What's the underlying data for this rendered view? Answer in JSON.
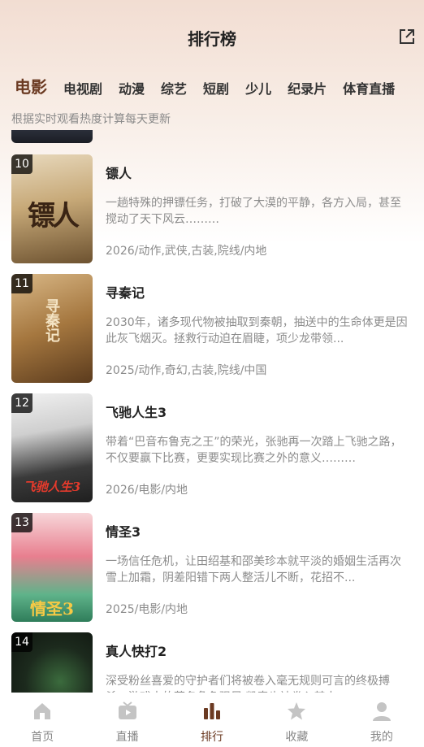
{
  "header": {
    "title": "排行榜"
  },
  "tabs": [
    "电影",
    "电视剧",
    "动漫",
    "综艺",
    "短剧",
    "少儿",
    "纪录片",
    "体育直播"
  ],
  "subtitle": "根据实时观看热度计算每天更新",
  "items": [
    {
      "rank": "10",
      "title": "镖人",
      "desc": "一趟特殊的押镖任务，打破了大漠的平静，各方入局，甚至搅动了天下风云………",
      "meta": "2026/动作,武侠,古装,院线/内地",
      "poster_text": "镖人"
    },
    {
      "rank": "11",
      "title": "寻秦记",
      "desc": "2030年，诸多现代物被抽取到秦朝，抽送中的生命体更是因此灰飞烟灭。拯救行动迫在眉睫，项少龙带领...",
      "meta": "2025/动作,奇幻,古装,院线/中国",
      "poster_text": "寻秦记"
    },
    {
      "rank": "12",
      "title": "飞驰人生3",
      "desc": "带着“巴音布鲁克之王”的荣光，张驰再一次踏上飞驰之路，不仅要赢下比赛，更要实现比赛之外的意义………",
      "meta": "2026/电影/内地",
      "poster_text": "飞驰人生3"
    },
    {
      "rank": "13",
      "title": "情圣3",
      "desc": "一场信任危机，让田绍基和邵美珍本就平淡的婚姻生活再次雪上加霜，阴差阳错下两人整活儿不断，花招不...",
      "meta": "2025/电影/内地",
      "poster_text": "情圣3"
    },
    {
      "rank": "14",
      "title": "真人快打2",
      "desc": "深受粉丝喜爱的守护者们将被卷入毫无规则可言的终极搏杀，游戏中的著名角色强尼·凯奇也被卷入其中...",
      "meta": "",
      "poster_text": ""
    }
  ],
  "nav": [
    {
      "label": "首页",
      "icon": "home-icon"
    },
    {
      "label": "直播",
      "icon": "tv-play-icon"
    },
    {
      "label": "排行",
      "icon": "ranking-bars-icon"
    },
    {
      "label": "收藏",
      "icon": "star-icon"
    },
    {
      "label": "我的",
      "icon": "user-icon"
    }
  ],
  "colors": {
    "accent": "#6b3a22",
    "muted": "#8c8c8c"
  }
}
